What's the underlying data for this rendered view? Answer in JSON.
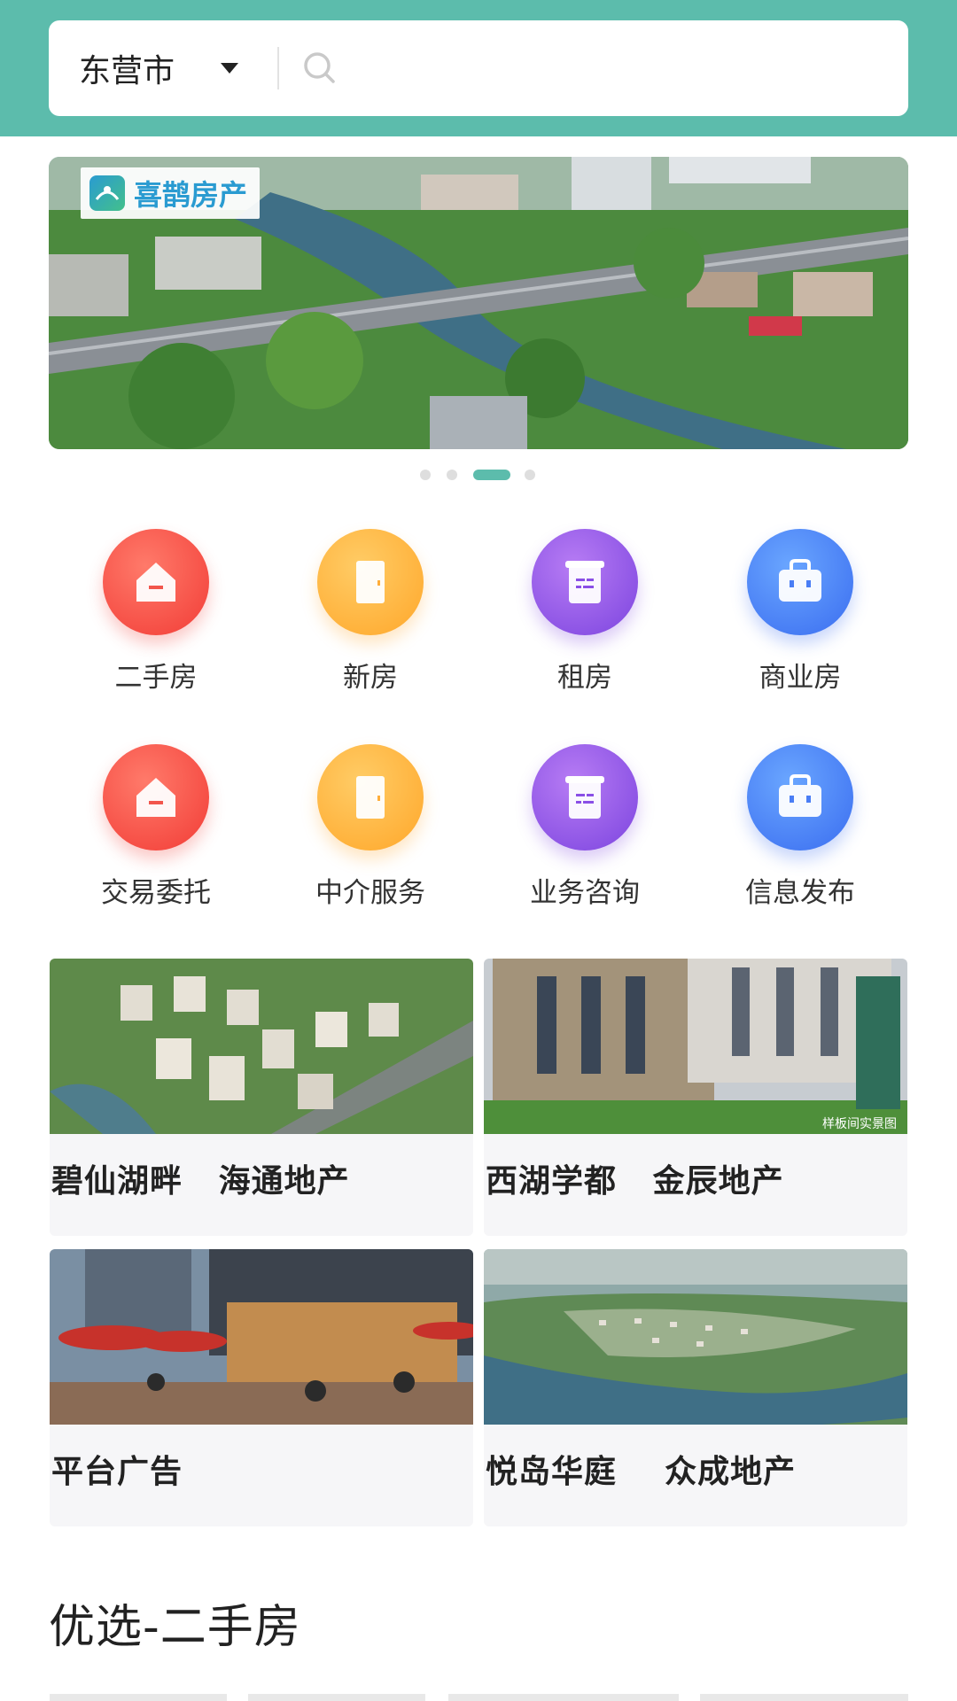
{
  "header": {
    "city": "东营市",
    "search_placeholder": ""
  },
  "banner": {
    "logo_text": "喜鹊房产",
    "dots_count": 4,
    "active_dot": 3
  },
  "categories": [
    {
      "label": "二手房",
      "color": "red",
      "icon": "house-icon"
    },
    {
      "label": "新房",
      "color": "orange",
      "icon": "door-icon"
    },
    {
      "label": "租房",
      "color": "purple",
      "icon": "scroll-icon"
    },
    {
      "label": "商业房",
      "color": "blue",
      "icon": "briefcase-icon"
    },
    {
      "label": "交易委托",
      "color": "red",
      "icon": "house-icon"
    },
    {
      "label": "中介服务",
      "color": "orange",
      "icon": "door-icon"
    },
    {
      "label": "业务咨询",
      "color": "purple",
      "icon": "scroll-icon"
    },
    {
      "label": "信息发布",
      "color": "blue",
      "icon": "briefcase-icon"
    }
  ],
  "properties": [
    {
      "title": "碧仙湖畔   海通地产"
    },
    {
      "title": "西湖学都   金辰地产",
      "image_caption": "样板间实景图"
    },
    {
      "title": "平台广告"
    },
    {
      "title": "悦岛华庭    众成地产"
    }
  ],
  "sections": {
    "featured_title": "优选-二手房"
  },
  "colors": {
    "brand_teal": "#5cbcac",
    "red": "#f23c36",
    "orange": "#ffa72a",
    "purple": "#7c44df",
    "blue": "#3a6df0"
  }
}
